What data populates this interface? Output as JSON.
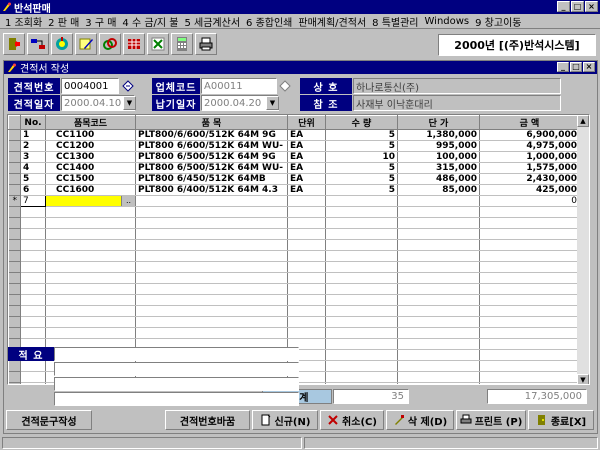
{
  "app": {
    "title": "반석판매"
  },
  "menu": [
    "1 조회화",
    "2 판 매",
    "3 구 매",
    "4 수 금/지 불",
    "5 세금계산서",
    "6 종합인쇄",
    "판매계획/견적서",
    "8 특별관리",
    "Windows",
    "9 창고이동"
  ],
  "toolbar": {
    "icons": [
      "exit-icon",
      "transfer-icon",
      "sync-icon",
      "edit-icon",
      "link-icon",
      "grid-icon",
      "cross-icon",
      "calculator-icon",
      "printer-icon"
    ],
    "company": "2000년  [(주)반석시스템]"
  },
  "child": {
    "title": "견적서 작성"
  },
  "form": {
    "estimate_no_label": "견적번호",
    "estimate_no": "0004001",
    "company_code_label": "업체코드",
    "company_code": "A00011",
    "trade_name_label": "상    호",
    "trade_name": "하나로통신(주)",
    "estimate_date_label": "견적일자",
    "estimate_date": "2000.04.10",
    "delivery_date_label": "납기일자",
    "delivery_date": "2000.04.20",
    "reference_label": "참    조",
    "reference": "사재부 이낙훈대리"
  },
  "grid": {
    "headers": [
      "No.",
      "품목코드",
      "품    목",
      "단위",
      "수    량",
      "단    가",
      "금    액"
    ],
    "rows": [
      [
        "1",
        "CC1100",
        "PLT800/6/600/512K 64M 9G",
        "EA",
        "5",
        "1,380,000",
        "6,900,000"
      ],
      [
        "2",
        "CC1200",
        "PLT800 6/600/512K 64M WU-",
        "EA",
        "5",
        "995,000",
        "4,975,000"
      ],
      [
        "3",
        "CC1300",
        "PLT800 6/500/512K 64M 9G",
        "EA",
        "10",
        "100,000",
        "1,000,000"
      ],
      [
        "4",
        "CC1400",
        "PLT800 6/500/512K 64M WU-",
        "EA",
        "5",
        "315,000",
        "1,575,000"
      ],
      [
        "5",
        "CC1500",
        "PLT800 6/450/512K 64MB",
        "EA",
        "5",
        "486,000",
        "2,430,000"
      ],
      [
        "6",
        "CC1600",
        "PLT800 6/400/512K 64M 4.3",
        "EA",
        "5",
        "85,000",
        "425,000"
      ]
    ],
    "new_row": {
      "marker": "*",
      "no": "7",
      "browse": "..",
      "amount": "0"
    }
  },
  "totals": {
    "label": "합    계",
    "quantity": "35",
    "amount": "17,305,000"
  },
  "remarks": {
    "label": "적    요"
  },
  "buttons": {
    "phrase": "견적문구작성",
    "renumber": "견적번호바꿈",
    "new": "신규(N)",
    "cancel": "취소(C)",
    "delete": "삭 제(D)",
    "print": "프린트 (P)",
    "close": "종료[X]"
  }
}
